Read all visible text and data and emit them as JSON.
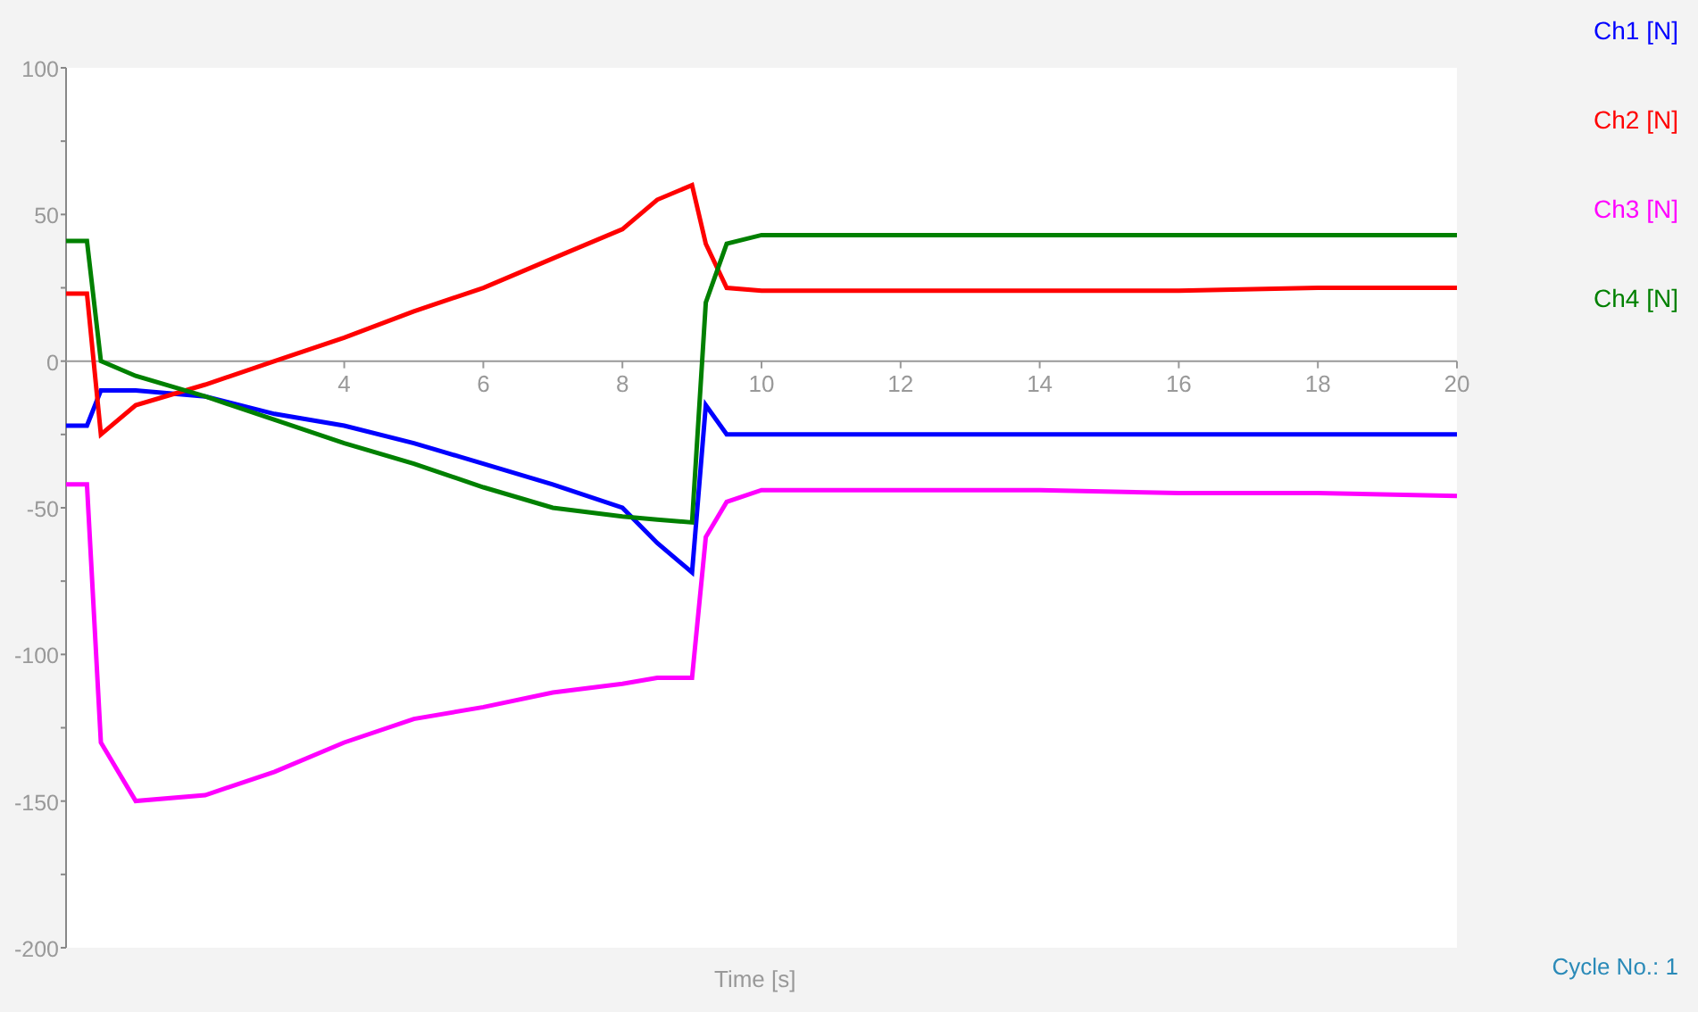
{
  "chart": {
    "chart_data": {
      "type": "line",
      "xlabel": "Time [s]",
      "xlim": [
        0,
        20
      ],
      "ylim": [
        -200,
        100
      ],
      "xticks": [
        4,
        6,
        8,
        10,
        12,
        14,
        16,
        18,
        20
      ],
      "yticks": [
        100,
        50,
        0,
        -50,
        -100,
        -150,
        -200
      ],
      "x": [
        0,
        0.3,
        0.5,
        1,
        2,
        3,
        4,
        5,
        6,
        7,
        8,
        8.5,
        9,
        9.2,
        9.5,
        10,
        12,
        14,
        16,
        18,
        20
      ],
      "series": [
        {
          "name": "Ch1 [N]",
          "color": "#0000ff",
          "values": [
            -22,
            -22,
            -10,
            -10,
            -12,
            -18,
            -22,
            -28,
            -35,
            -42,
            -50,
            -62,
            -72,
            -15,
            -25,
            -25,
            -25,
            -25,
            -25,
            -25,
            -25
          ]
        },
        {
          "name": "Ch2 [N]",
          "color": "#ff0000",
          "values": [
            23,
            23,
            -25,
            -15,
            -8,
            0,
            8,
            17,
            25,
            35,
            45,
            55,
            60,
            40,
            25,
            24,
            24,
            24,
            24,
            25,
            25
          ]
        },
        {
          "name": "Ch3 [N]",
          "color": "#ff00ff",
          "values": [
            -42,
            -42,
            -130,
            -150,
            -148,
            -140,
            -130,
            -122,
            -118,
            -113,
            -110,
            -108,
            -108,
            -60,
            -48,
            -44,
            -44,
            -44,
            -45,
            -45,
            -46
          ]
        },
        {
          "name": "Ch4 [N]",
          "color": "#008000",
          "values": [
            41,
            41,
            0,
            -5,
            -12,
            -20,
            -28,
            -35,
            -43,
            -50,
            -53,
            -54,
            -55,
            20,
            40,
            43,
            43,
            43,
            43,
            43,
            43
          ]
        }
      ]
    }
  },
  "cycle": "Cycle No.: 1"
}
